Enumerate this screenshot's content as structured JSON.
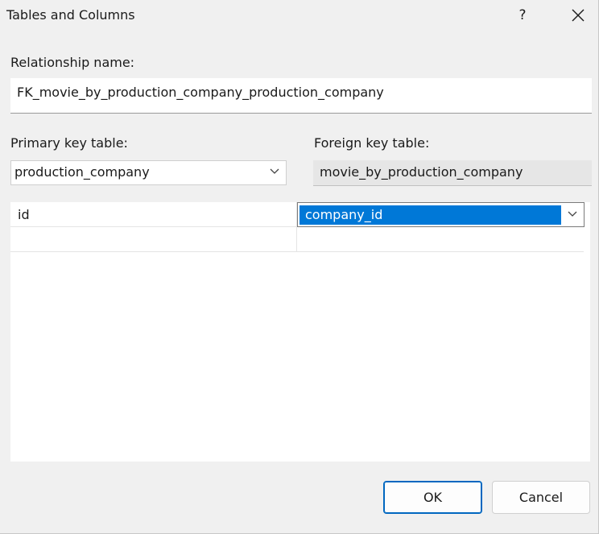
{
  "window": {
    "title": "Tables and Columns",
    "help_label": "?"
  },
  "relationship": {
    "label": "Relationship name:",
    "value": "FK_movie_by_production_company_production_company"
  },
  "primary_key": {
    "label": "Primary key table:",
    "selected": "production_company"
  },
  "foreign_key": {
    "label": "Foreign key table:",
    "value": "movie_by_production_company"
  },
  "columns": {
    "rows": [
      {
        "primary": "id",
        "foreign": "company_id"
      },
      {
        "primary": "",
        "foreign": ""
      }
    ]
  },
  "buttons": {
    "ok": "OK",
    "cancel": "Cancel"
  },
  "colors": {
    "selection": "#0078d7",
    "ok_border": "#0067c0"
  }
}
